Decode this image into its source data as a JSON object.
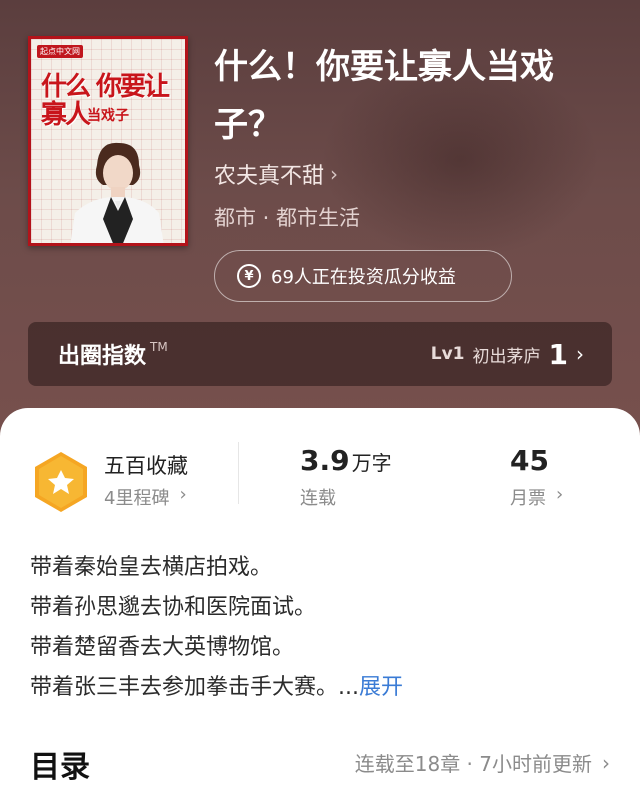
{
  "book": {
    "cover_brand": "起点中文网",
    "cover_title": "什么 你要让寡人",
    "cover_sub": "当戏子",
    "title": "什么！你要让寡人当戏子？",
    "author": "农夫真不甜",
    "genre": "都市 · 都市生活",
    "invest_text": "69人正在投资瓜分收益"
  },
  "breakout": {
    "title": "出圈指数",
    "tm": "TM",
    "level_code": "Lv1",
    "level_name": "初出茅庐",
    "rank_number": "1"
  },
  "stats": {
    "favorites": "五百收藏",
    "milestone": "4里程碑",
    "words_value": "3.9",
    "words_unit": "万字",
    "serial_status": "连载",
    "monthly_votes": "45",
    "monthly_votes_label": "月票"
  },
  "intro": {
    "lines": [
      "带着秦始皇去横店拍戏。",
      "带着孙思邈去协和医院面试。",
      "带着楚留香去大英博物馆。",
      "带着张三丰去参加拳击手大赛。"
    ],
    "ellipsis": "...",
    "expand_label": "展开"
  },
  "toc": {
    "title": "目录",
    "status": "连载至18章 · 7小时前更新"
  },
  "icons": {
    "chevron": "chevron-right-icon",
    "yen": "yen-coin-icon",
    "badge": "star-badge-icon"
  },
  "colors": {
    "accent_link": "#3a7bd5",
    "badge_orange": "#f5a623",
    "cover_red": "#c8151b"
  }
}
